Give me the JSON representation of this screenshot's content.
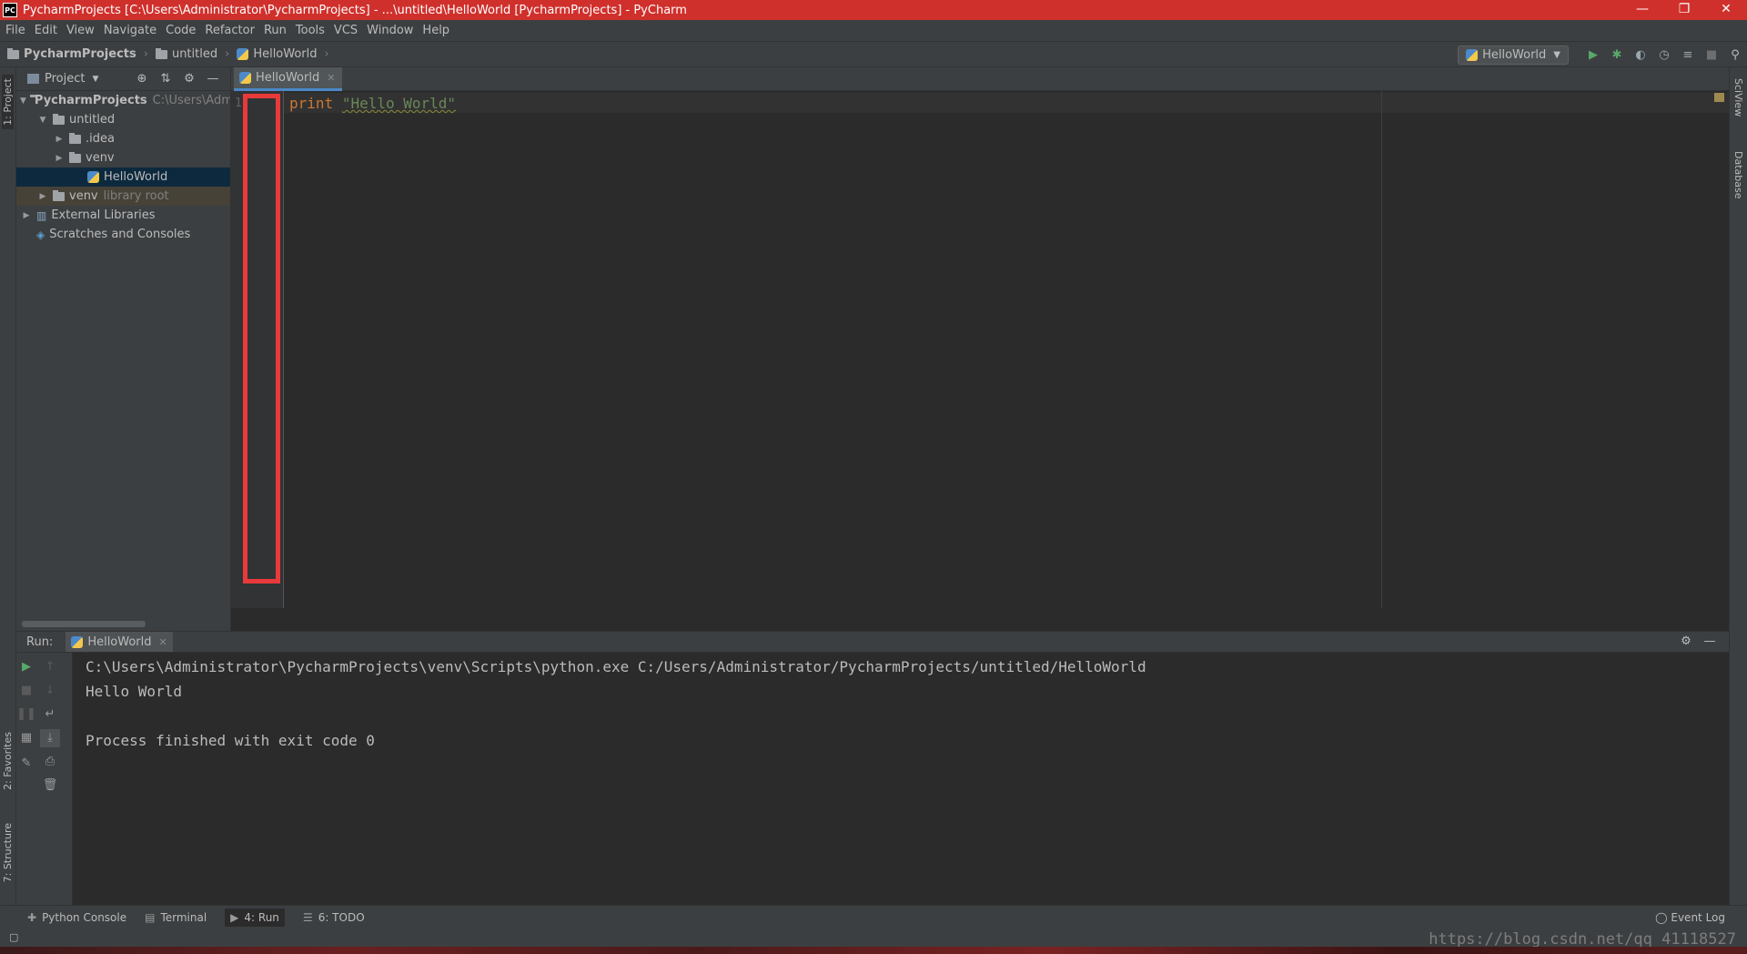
{
  "window": {
    "title": "PycharmProjects [C:\\Users\\Administrator\\PycharmProjects] - ...\\untitled\\HelloWorld [PycharmProjects] - PyCharm",
    "app_icon": "PC"
  },
  "menu": [
    "File",
    "Edit",
    "View",
    "Navigate",
    "Code",
    "Refactor",
    "Run",
    "Tools",
    "VCS",
    "Window",
    "Help"
  ],
  "breadcrumb": [
    "PycharmProjects",
    "untitled",
    "HelloWorld"
  ],
  "run_config": "HelloWorld",
  "left_strip": {
    "project_tab": "1: Project",
    "favorites_tab": "2: Favorites",
    "structure_tab": "7: Structure"
  },
  "right_strip": {
    "sciview_tab": "SciView",
    "database_tab": "Database"
  },
  "project_panel": {
    "title": "Project",
    "tree": [
      {
        "label": "PycharmProjects",
        "hint": "C:\\Users\\Admi",
        "type": "folder",
        "arrow": "▼",
        "depth": 0
      },
      {
        "label": "untitled",
        "hint": "",
        "type": "folder",
        "arrow": "▼",
        "depth": 1
      },
      {
        "label": ".idea",
        "hint": "",
        "type": "folder",
        "arrow": "▶",
        "depth": 2
      },
      {
        "label": "venv",
        "hint": "",
        "type": "folder",
        "arrow": "▶",
        "depth": 2
      },
      {
        "label": "HelloWorld",
        "hint": "",
        "type": "python-file",
        "arrow": "",
        "depth": 3
      },
      {
        "label": "venv",
        "hint": "library root",
        "type": "folder",
        "arrow": "▶",
        "depth": 1
      },
      {
        "label": "External Libraries",
        "hint": "",
        "type": "libraries",
        "arrow": "▶",
        "depth": 0
      },
      {
        "label": "Scratches and Consoles",
        "hint": "",
        "type": "scratches",
        "arrow": "",
        "depth": 0
      }
    ]
  },
  "editor": {
    "tab": "HelloWorld",
    "line_number": "1",
    "code_keyword": "print",
    "code_string": "\"Hello World\""
  },
  "run_panel": {
    "label": "Run:",
    "tab": "HelloWorld",
    "output": [
      "C:\\Users\\Administrator\\PycharmProjects\\venv\\Scripts\\python.exe C:/Users/Administrator/PycharmProjects/untitled/HelloWorld",
      "Hello World",
      "",
      "Process finished with exit code 0"
    ]
  },
  "bottom_tabs": [
    {
      "label": "Python Console",
      "icon": "python-icon"
    },
    {
      "label": "Terminal",
      "icon": "terminal-icon"
    },
    {
      "label": "4: Run",
      "icon": "run-icon"
    },
    {
      "label": "6: TODO",
      "icon": "todo-icon"
    }
  ],
  "event_log": "Event Log",
  "watermark": "https://blog.csdn.net/qq_41118527",
  "colors": {
    "title_bar": "#d0302c",
    "highlight_box": "#e83a3a",
    "selection": "#0d293e",
    "keyword": "#cc7832",
    "string": "#6a8759"
  }
}
